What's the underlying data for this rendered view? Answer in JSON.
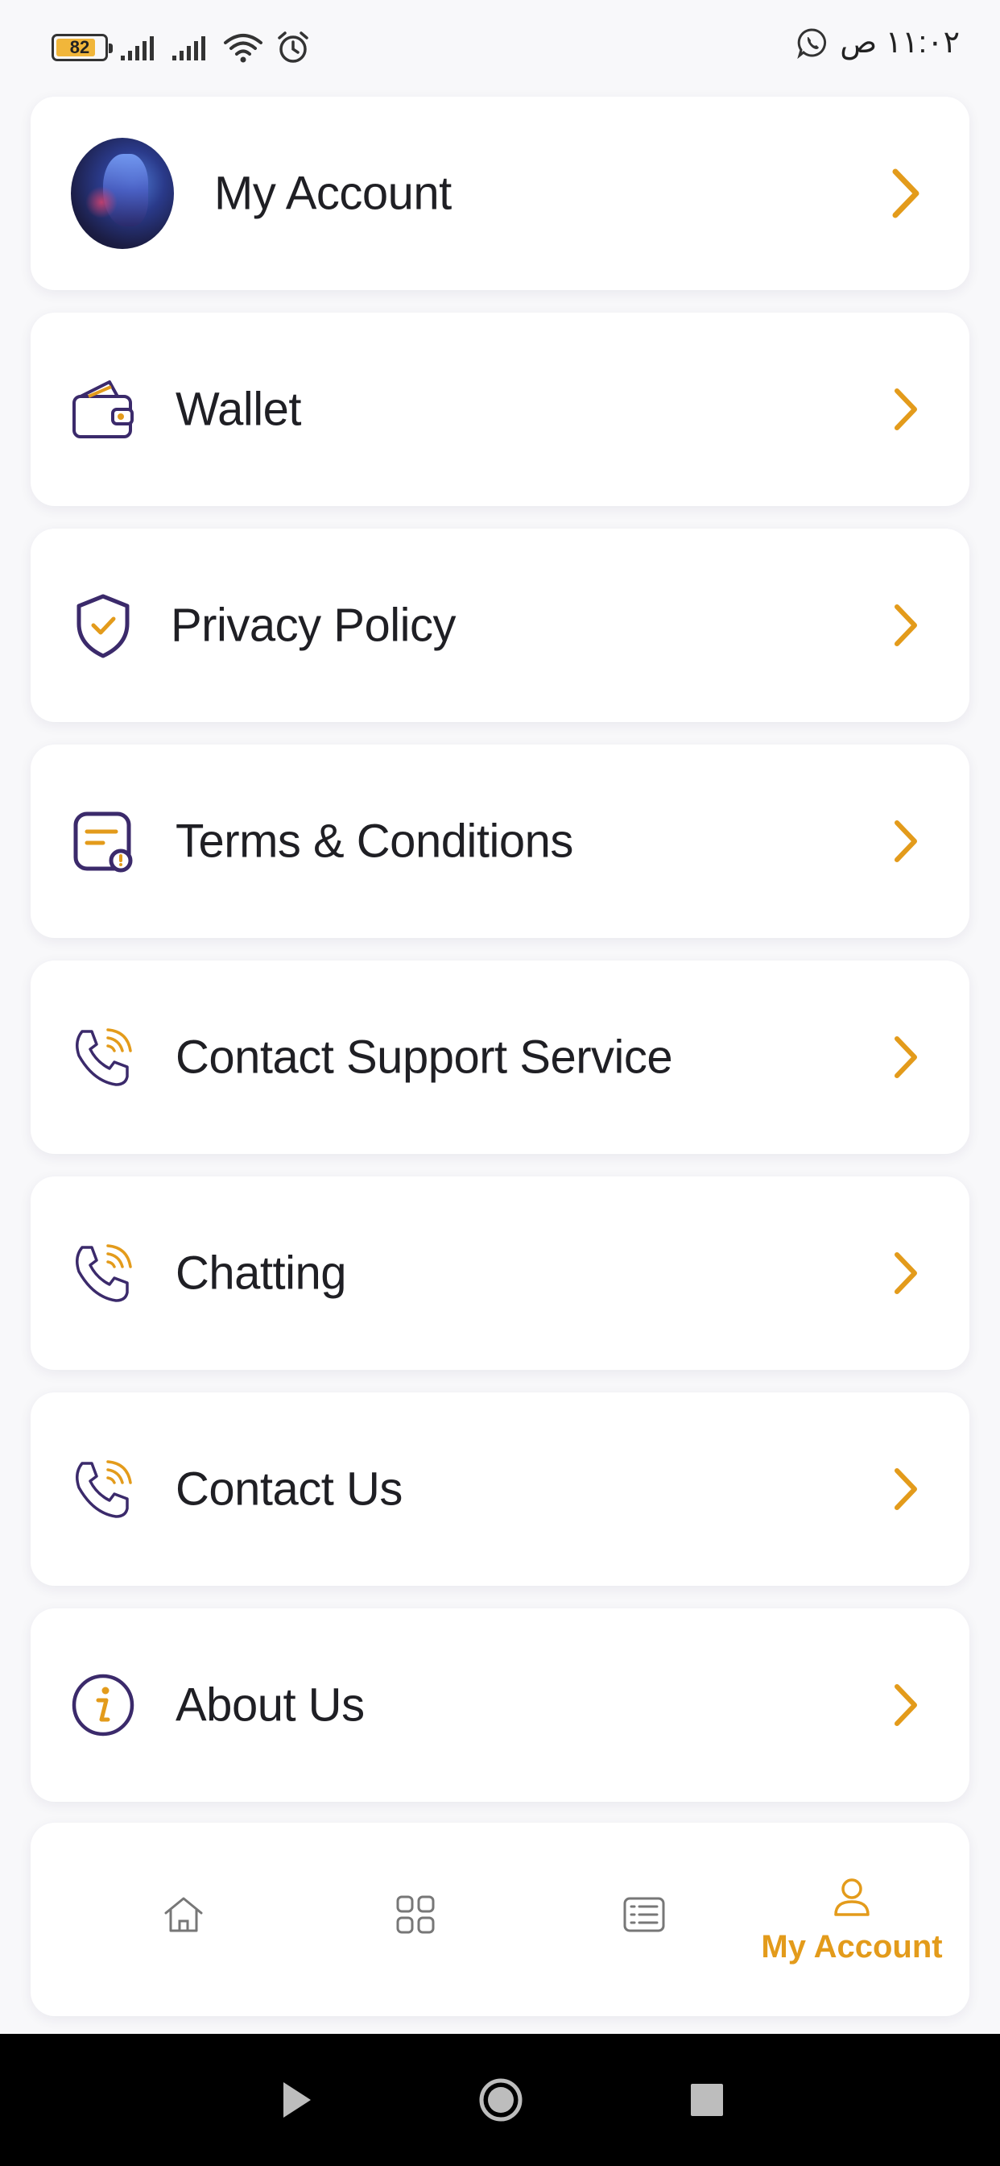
{
  "status_bar": {
    "battery": "82",
    "battery_level": 0.82,
    "time": "١١:٠٢ ص"
  },
  "menu": {
    "items": [
      {
        "label": "My Account",
        "icon": "avatar"
      },
      {
        "label": "Wallet",
        "icon": "wallet-icon"
      },
      {
        "label": "Privacy Policy",
        "icon": "shield-check-icon"
      },
      {
        "label": "Terms & Conditions",
        "icon": "document-alert-icon"
      },
      {
        "label": "Contact Support Service",
        "icon": "phone-ringing-icon"
      },
      {
        "label": "Chatting",
        "icon": "phone-ringing-icon"
      },
      {
        "label": "Contact Us",
        "icon": "phone-ringing-icon"
      },
      {
        "label": "About Us",
        "icon": "info-icon"
      }
    ]
  },
  "bottom_nav": {
    "items": [
      {
        "label": "",
        "icon": "home-icon",
        "active": false
      },
      {
        "label": "",
        "icon": "grid-icon",
        "active": false
      },
      {
        "label": "",
        "icon": "list-icon",
        "active": false
      },
      {
        "label": "My Account",
        "icon": "user-icon",
        "active": true
      }
    ]
  },
  "colors": {
    "accent": "#e39b1b",
    "icon_primary": "#3b2a6b",
    "background": "#f8f8fa",
    "card": "#ffffff",
    "text": "#1f1f24"
  }
}
